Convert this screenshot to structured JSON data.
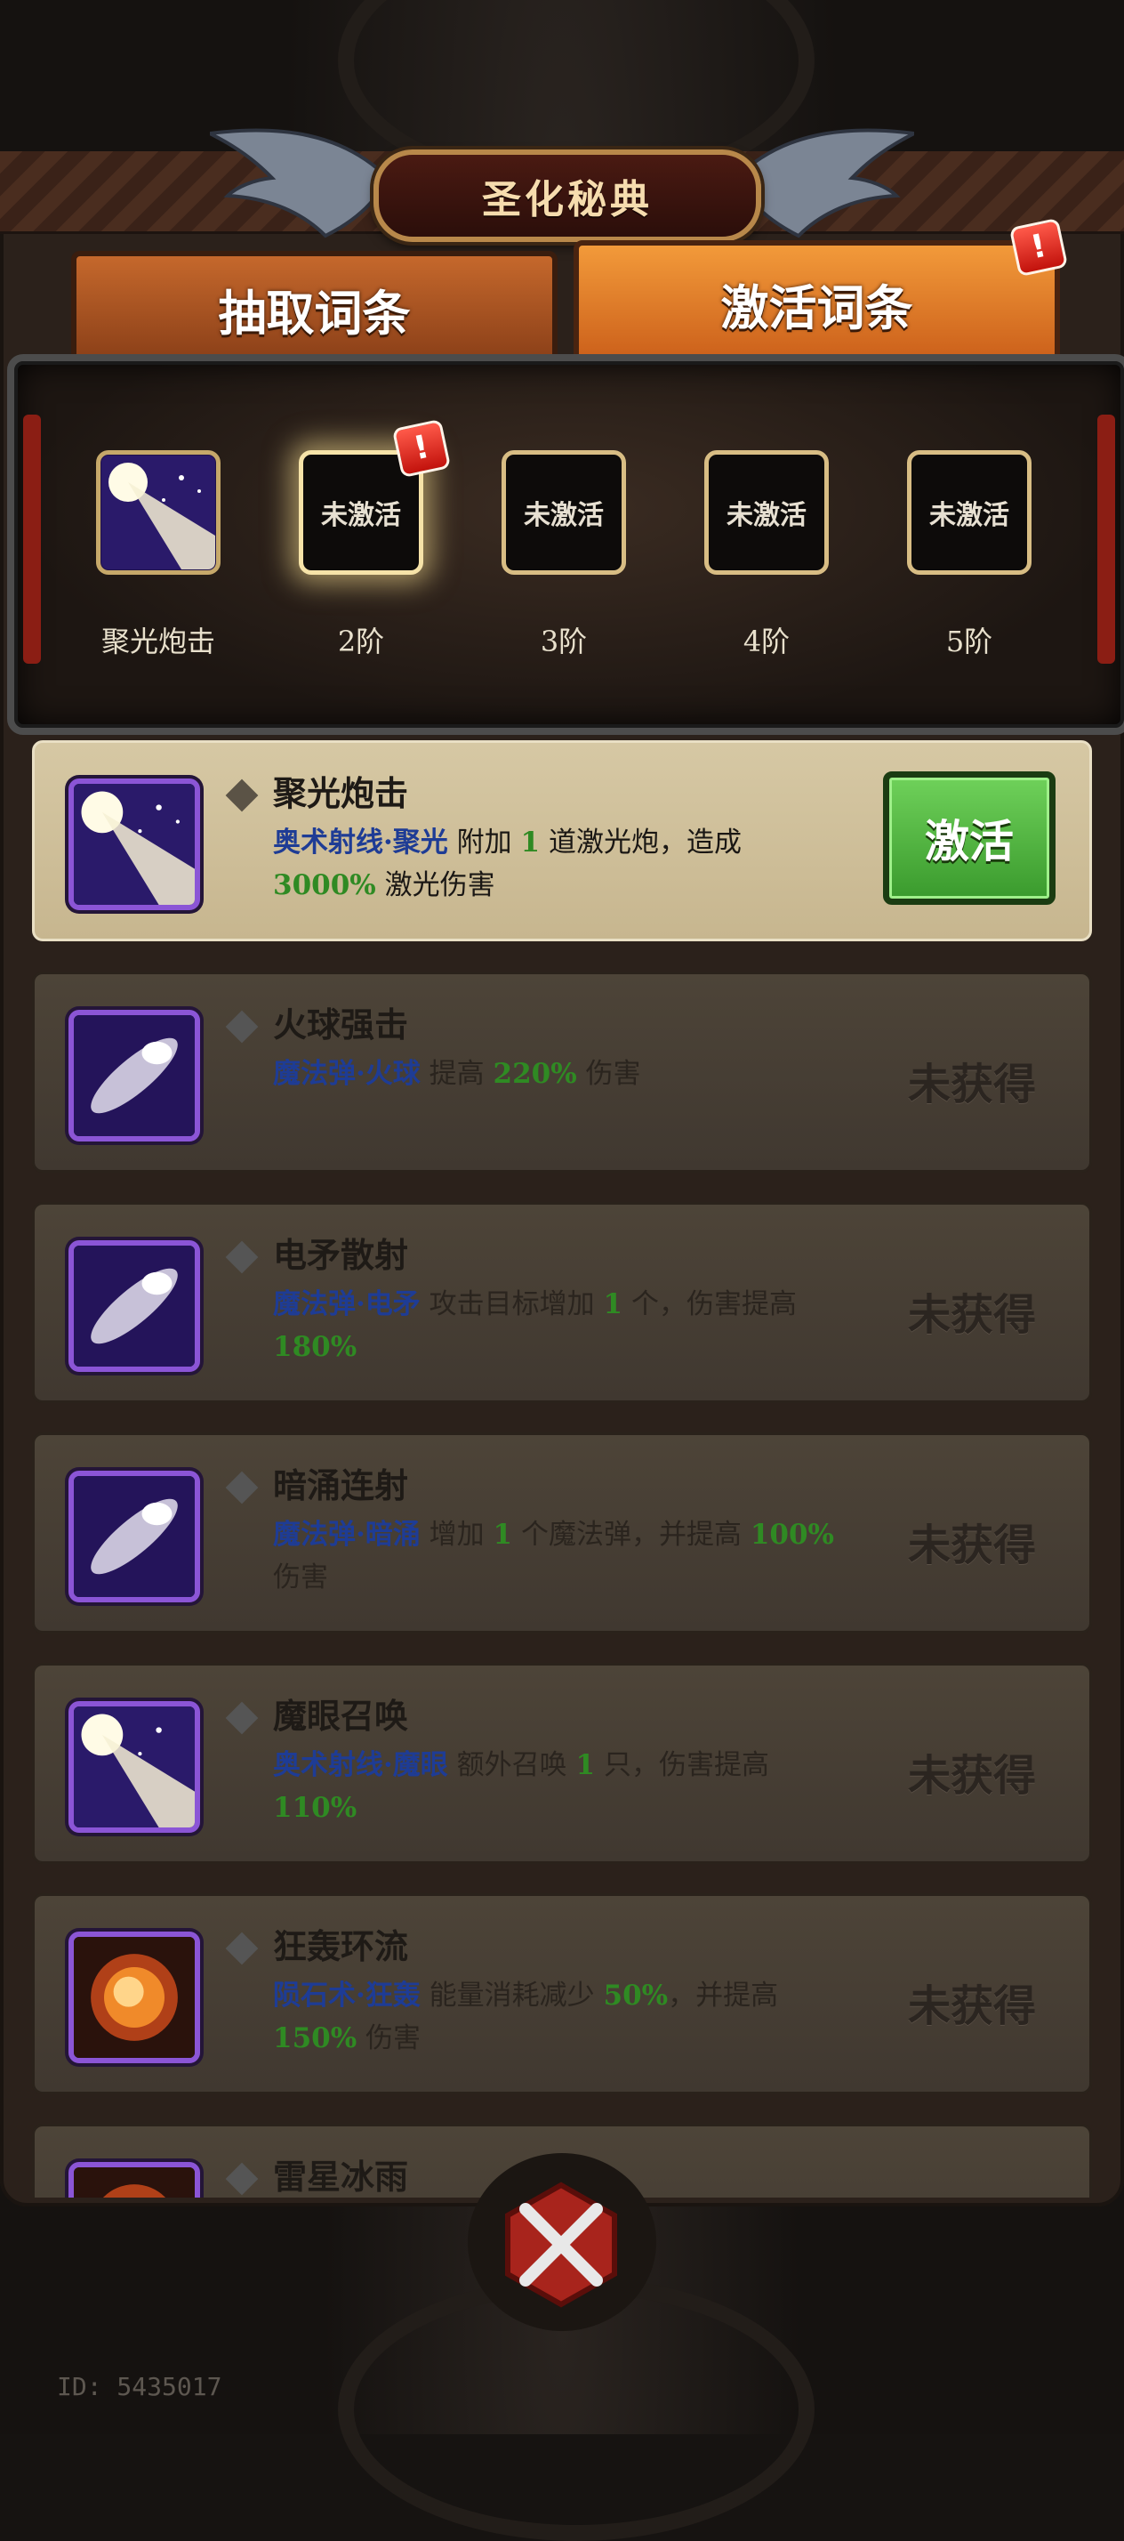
{
  "header": {
    "title": "圣化秘典"
  },
  "tabs": [
    {
      "label": "抽取词条"
    },
    {
      "label": "激活词条",
      "badge": "!"
    }
  ],
  "tiers": [
    {
      "label": "聚光炮击",
      "state": "owned",
      "icon": "light-beam-icon"
    },
    {
      "label": "2阶",
      "box_text": "未激活",
      "badge": "!"
    },
    {
      "label": "3阶",
      "box_text": "未激活"
    },
    {
      "label": "4阶",
      "box_text": "未激活"
    },
    {
      "label": "5阶",
      "box_text": "未激活"
    }
  ],
  "entries": [
    {
      "name": "聚光炮击",
      "desc_prefix": "奥术射线·聚光",
      "desc_mid1": " 附加 ",
      "num1": "1",
      "desc_mid2": " 道激光炮，造成 ",
      "num2": "3000%",
      "desc_suffix": " 激光伤害",
      "icon": "light-beam-icon",
      "button": "激活"
    },
    {
      "name": "火球强击",
      "desc_prefix": "魔法弹·火球",
      "desc_mid1": " 提高 ",
      "num1": "220%",
      "desc_suffix": " 伤害",
      "icon": "magic-bolt-icon",
      "status": "未获得"
    },
    {
      "name": "电矛散射",
      "desc_prefix": "魔法弹·电矛",
      "desc_mid1": " 攻击目标增加 ",
      "num1": "1",
      "desc_mid2": " 个，伤害提高 ",
      "num2": "180%",
      "icon": "magic-bolt-icon",
      "status": "未获得"
    },
    {
      "name": "暗涌连射",
      "desc_prefix": "魔法弹·暗涌",
      "desc_mid1": " 增加 ",
      "num1": "1",
      "desc_mid2": " 个魔法弹，并提高 ",
      "num2": "100%",
      "desc_suffix": " 伤害",
      "icon": "magic-bolt-icon",
      "status": "未获得"
    },
    {
      "name": "魔眼召唤",
      "desc_prefix": "奥术射线·魔眼",
      "desc_mid1": " 额外召唤 ",
      "num1": "1",
      "desc_mid2": " 只，伤害提高 ",
      "num2": "110%",
      "icon": "light-beam-icon",
      "status": "未获得"
    },
    {
      "name": "狂轰环流",
      "desc_prefix": "陨石术·狂轰",
      "desc_mid1": " 能量消耗减少 ",
      "num1": "50%",
      "desc_mid2": "，并提高 ",
      "num2": "150%",
      "desc_suffix": " 伤害",
      "icon": "meteor-icon",
      "status": "未获得"
    },
    {
      "name": "雷星冰雨",
      "icon": "meteor-icon"
    }
  ],
  "footer": {
    "player_id": "ID: 5435017"
  }
}
